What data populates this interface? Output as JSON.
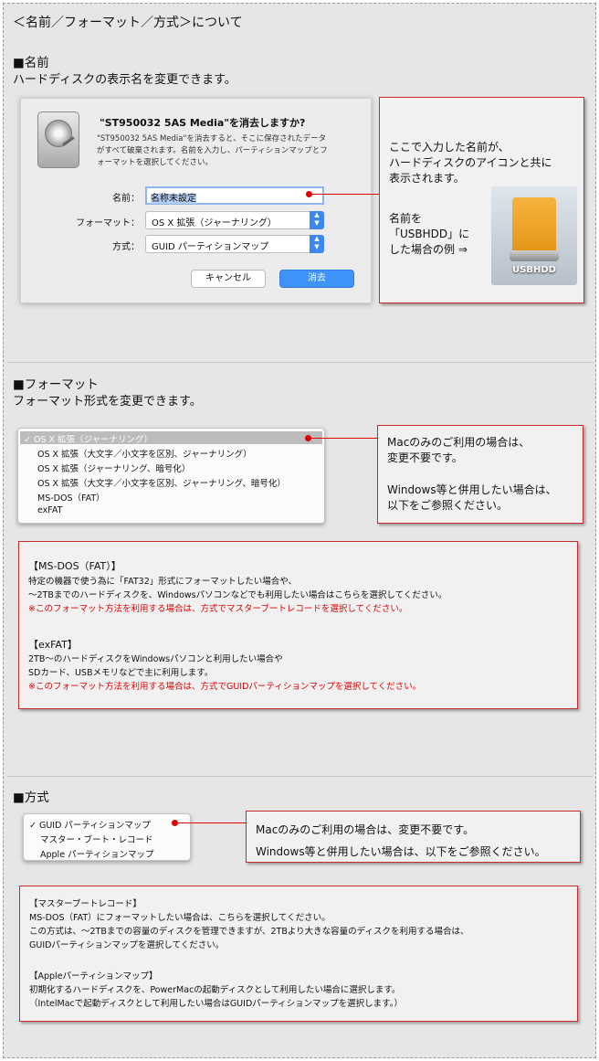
{
  "page_title": "＜名前／フォーマット／方式＞について",
  "name_section": {
    "heading": "■名前",
    "desc": "ハードディスクの表示名を変更できます。"
  },
  "dialog": {
    "title": "\"ST950032 5AS Media\"を消去しますか?",
    "desc_lines": [
      "\"ST950032 5AS Media\"を消去すると、そこに保存されたデータ",
      "がすべて破棄されます。名前を入力し、パーティションマップとフ",
      "ォーマットを選択してください。"
    ],
    "name_label": "名前：",
    "name_value": "名称未設定",
    "format_label": "フォーマット：",
    "format_value": "OS X 拡張（ジャーナリング）",
    "scheme_label": "方式：",
    "scheme_value": "GUID パーティションマップ",
    "cancel": "キャンセル",
    "erase": "消去"
  },
  "name_note": {
    "lines": [
      "ここで入力した名前が、",
      "ハードディスクのアイコンと共に",
      "表示されます。"
    ],
    "example_lines": [
      "名前を",
      "「USBHDD」に",
      "した場合の例 ⇒"
    ],
    "icon_caption": "USBHDD"
  },
  "format_section": {
    "heading": "■フォーマット",
    "desc": "フォーマット形式を変更できます。",
    "menu": [
      "✓ OS X 拡張（ジャーナリング）",
      "OS X 拡張（大文字／小文字を区別、ジャーナリング）",
      "OS X 拡張（ジャーナリング、暗号化）",
      "OS X 拡張（大文字／小文字を区別、ジャーナリング、暗号化）",
      "MS-DOS（FAT）",
      "exFAT"
    ],
    "note_lines": [
      "Macのみのご利用の場合は、",
      "変更不要です。",
      "Windows等と併用したい場合は、",
      "以下をご参照ください。"
    ],
    "info": {
      "msdos_title": "【MS-DOS（FAT）】",
      "msdos_lines": [
        "特定の機器で使う為に「FAT32」形式にフォーマットしたい場合や、",
        "～2TBまでのハードディスクを、Windowsパソコンなどでも利用したい場合はこちらを選択してください。"
      ],
      "msdos_warn": "※このフォーマット方法を利用する場合は、方式でマスターブートレコードを選択してください。",
      "exfat_title": "【exFAT】",
      "exfat_lines": [
        "2TB～のハードディスクをWindowsパソコンと利用したい場合や",
        "SDカード、USBメモリなどで主に利用します。"
      ],
      "exfat_warn": "※このフォーマット方法を利用する場合は、方式でGUIDパーティションマップを選択してください。"
    }
  },
  "scheme_section": {
    "heading": "■方式",
    "menu": [
      "✓ GUID パーティションマップ",
      "マスター・ブート・レコード",
      "Apple パーティションマップ"
    ],
    "note_lines": [
      "Macのみのご利用の場合は、変更不要です。",
      "Windows等と併用したい場合は、以下をご参照ください。"
    ],
    "info": {
      "mbr_title": "【マスターブートレコード】",
      "mbr_lines": [
        "MS-DOS（FAT）にフォーマットしたい場合は、こちらを選択してください。",
        "この方式は、～2TBまでの容量のディスクを管理できますが、2TBより大きな容量のディスクを利用する場合は、",
        "GUIDパーティションマップを選択してください。"
      ],
      "apm_title": "【Appleパーティションマップ】",
      "apm_lines": [
        "初期化するハードディスクを、PowerMacの起動ディスクとして利用したい場合に選択します。",
        "（IntelMacで起動ディスクとして利用したい場合はGUIDパーティションマップを選択します。）"
      ]
    }
  },
  "colors": {
    "accent_red": "#e00000",
    "mac_blue": "#3f92f7"
  }
}
